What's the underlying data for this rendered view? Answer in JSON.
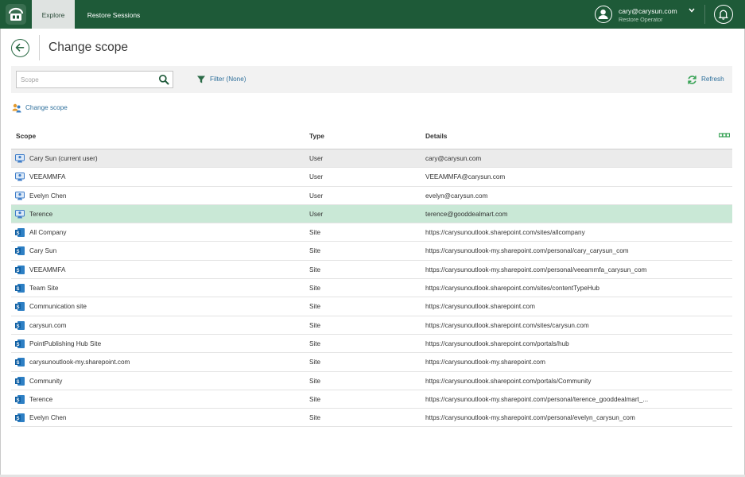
{
  "nav": {
    "tabs": [
      {
        "label": "Explore",
        "active": true
      },
      {
        "label": "Restore Sessions",
        "active": false
      }
    ]
  },
  "user": {
    "name": "cary@carysun.com",
    "role": "Restore Operator"
  },
  "page": {
    "title": "Change scope"
  },
  "toolbar": {
    "search_placeholder": "Scope",
    "search_value": "",
    "filter_label": "Filter (None)",
    "refresh_label": "Refresh"
  },
  "change_scope_label": "Change scope",
  "table": {
    "columns": [
      "Scope",
      "Type",
      "Details"
    ],
    "rows": [
      {
        "scope": "Cary Sun (current user)",
        "type": "User",
        "details": "cary@carysun.com",
        "icon": "user-icon",
        "state": "hover"
      },
      {
        "scope": "VEEAMMFA",
        "type": "User",
        "details": "VEEAMMFA@carysun.com",
        "icon": "user-icon",
        "state": ""
      },
      {
        "scope": "Evelyn Chen",
        "type": "User",
        "details": "evelyn@carysun.com",
        "icon": "user-icon",
        "state": ""
      },
      {
        "scope": "Terence",
        "type": "User",
        "details": "terence@gooddealmart.com",
        "icon": "user-icon",
        "state": "selected"
      },
      {
        "scope": "All Company",
        "type": "Site",
        "details": "https://carysunoutlook.sharepoint.com/sites/allcompany",
        "icon": "sharepoint-icon",
        "state": ""
      },
      {
        "scope": "Cary Sun",
        "type": "Site",
        "details": "https://carysunoutlook-my.sharepoint.com/personal/cary_carysun_com",
        "icon": "sharepoint-icon",
        "state": ""
      },
      {
        "scope": "VEEAMMFA",
        "type": "Site",
        "details": "https://carysunoutlook-my.sharepoint.com/personal/veeammfa_carysun_com",
        "icon": "sharepoint-icon",
        "state": ""
      },
      {
        "scope": "Team Site",
        "type": "Site",
        "details": "https://carysunoutlook.sharepoint.com/sites/contentTypeHub",
        "icon": "sharepoint-icon",
        "state": ""
      },
      {
        "scope": "Communication site",
        "type": "Site",
        "details": "https://carysunoutlook.sharepoint.com",
        "icon": "sharepoint-icon",
        "state": ""
      },
      {
        "scope": "carysun.com",
        "type": "Site",
        "details": "https://carysunoutlook.sharepoint.com/sites/carysun.com",
        "icon": "sharepoint-icon",
        "state": ""
      },
      {
        "scope": "PointPublishing Hub Site",
        "type": "Site",
        "details": "https://carysunoutlook.sharepoint.com/portals/hub",
        "icon": "sharepoint-icon",
        "state": ""
      },
      {
        "scope": "carysunoutlook-my.sharepoint.com",
        "type": "Site",
        "details": "https://carysunoutlook-my.sharepoint.com",
        "icon": "sharepoint-icon",
        "state": ""
      },
      {
        "scope": "Community",
        "type": "Site",
        "details": "https://carysunoutlook.sharepoint.com/portals/Community",
        "icon": "sharepoint-icon",
        "state": ""
      },
      {
        "scope": "Terence",
        "type": "Site",
        "details": "https://carysunoutlook-my.sharepoint.com/personal/terence_gooddealmart_...",
        "icon": "sharepoint-icon",
        "state": ""
      },
      {
        "scope": "Evelyn Chen",
        "type": "Site",
        "details": "https://carysunoutlook-my.sharepoint.com/personal/evelyn_carysun_com",
        "icon": "sharepoint-icon",
        "state": ""
      }
    ]
  },
  "colors": {
    "topbar": "#1e5a38",
    "link": "#2d6f9b",
    "selected_row": "#c9e8d6",
    "accent_green": "#2c6b46"
  }
}
